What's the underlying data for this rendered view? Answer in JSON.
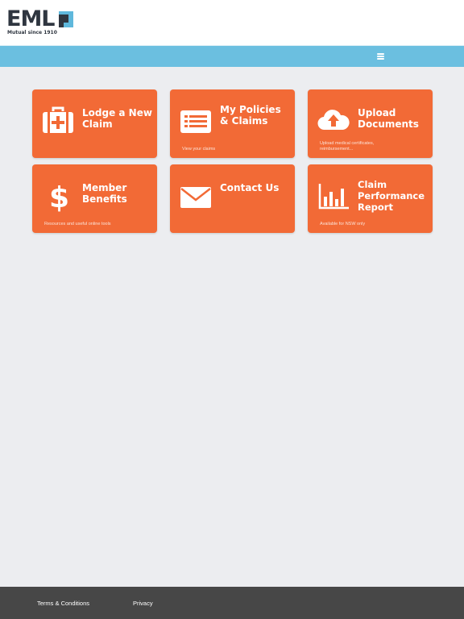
{
  "header": {
    "logo_text": "EML",
    "logo_tagline": "Mutual since 1910"
  },
  "navbar": {
    "menu_icon": "hamburger-icon",
    "color": "#6bbfe0"
  },
  "tiles": [
    {
      "title": "Lodge a New Claim",
      "description": "",
      "icon": "first-aid-kit-icon"
    },
    {
      "title": "My Policies & Claims",
      "description": "View your claims",
      "icon": "list-card-icon"
    },
    {
      "title": "Upload Documents",
      "description": "Upload medical certificates, reimbursement...",
      "icon": "cloud-upload-icon"
    },
    {
      "title": "Member Benefits",
      "description": "Resources and useful online tools",
      "icon": "dollar-icon"
    },
    {
      "title": "Contact Us",
      "description": "",
      "icon": "envelope-icon"
    },
    {
      "title": "Claim Performance Report",
      "description": "Available for NSW only",
      "icon": "bar-chart-icon"
    }
  ],
  "tile_color": "#f26a36",
  "footer": {
    "terms": "Terms & Conditions",
    "privacy": "Privacy"
  }
}
